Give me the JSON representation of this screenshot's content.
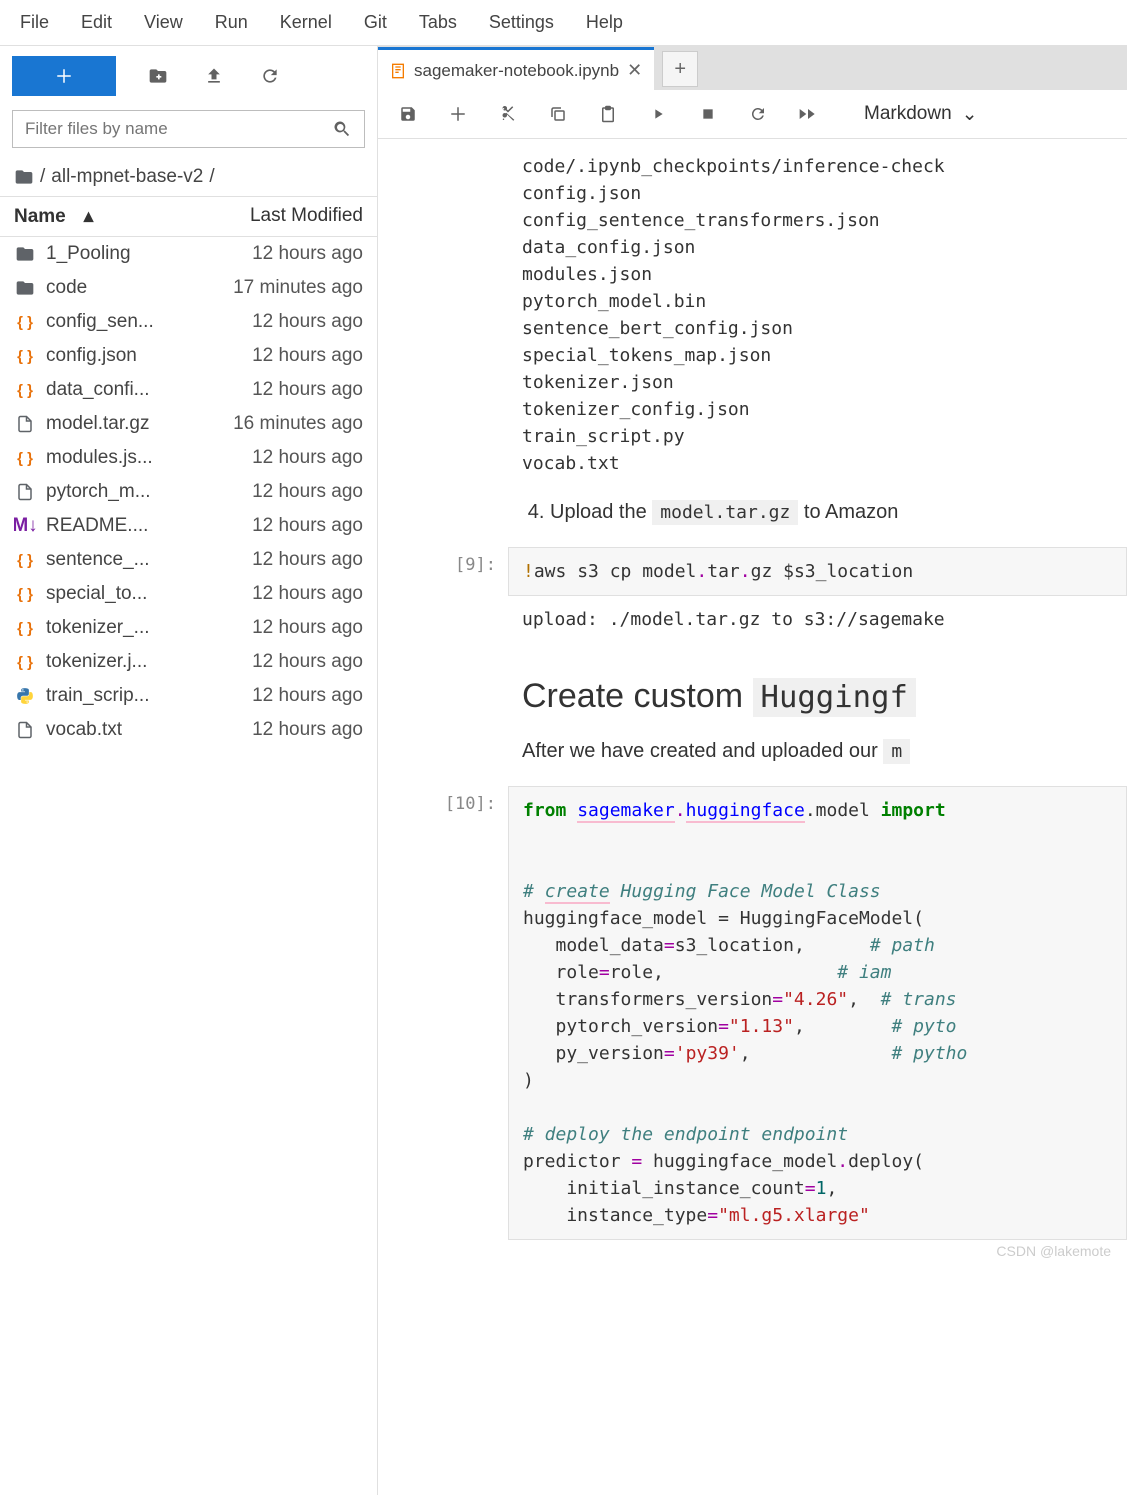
{
  "menubar": [
    "File",
    "Edit",
    "View",
    "Run",
    "Kernel",
    "Git",
    "Tabs",
    "Settings",
    "Help"
  ],
  "sidebar": {
    "filter_placeholder": "Filter files by name",
    "breadcrumb_path": "all-mpnet-base-v2",
    "columns": {
      "name": "Name",
      "modified": "Last Modified"
    },
    "files": [
      {
        "icon": "folder",
        "name": "1_Pooling",
        "modified": "12 hours ago"
      },
      {
        "icon": "folder",
        "name": "code",
        "modified": "17 minutes ago"
      },
      {
        "icon": "json",
        "name": "config_sen...",
        "modified": "12 hours ago"
      },
      {
        "icon": "json",
        "name": "config.json",
        "modified": "12 hours ago"
      },
      {
        "icon": "json",
        "name": "data_confi...",
        "modified": "12 hours ago"
      },
      {
        "icon": "file",
        "name": "model.tar.gz",
        "modified": "16 minutes ago"
      },
      {
        "icon": "json",
        "name": "modules.js...",
        "modified": "12 hours ago"
      },
      {
        "icon": "file",
        "name": "pytorch_m...",
        "modified": "12 hours ago"
      },
      {
        "icon": "md",
        "name": "README....",
        "modified": "12 hours ago"
      },
      {
        "icon": "json",
        "name": "sentence_...",
        "modified": "12 hours ago"
      },
      {
        "icon": "json",
        "name": "special_to...",
        "modified": "12 hours ago"
      },
      {
        "icon": "json",
        "name": "tokenizer_...",
        "modified": "12 hours ago"
      },
      {
        "icon": "json",
        "name": "tokenizer.j...",
        "modified": "12 hours ago"
      },
      {
        "icon": "py",
        "name": "train_scrip...",
        "modified": "12 hours ago"
      },
      {
        "icon": "file",
        "name": "vocab.txt",
        "modified": "12 hours ago"
      }
    ]
  },
  "tab": {
    "title": "sagemaker-notebook.ipynb"
  },
  "nb_toolbar": {
    "cell_type": "Markdown"
  },
  "notebook": {
    "output_files": "code/.ipynb_checkpoints/inference-check\nconfig.json\nconfig_sentence_transformers.json\ndata_config.json\nmodules.json\npytorch_model.bin\nsentence_bert_config.json\nspecial_tokens_map.json\ntokenizer.json\ntokenizer_config.json\ntrain_script.py\nvocab.txt",
    "step4_prefix": "Upload the ",
    "step4_code": "model.tar.gz",
    "step4_suffix": " to Amazon",
    "cell9_prompt": "[9]:",
    "cell9_code": {
      "mag": "!",
      "plain1": "aws s3 cp model",
      "dot1": ".",
      "plain2": "tar",
      "dot2": ".",
      "plain3": "gz $s3_location"
    },
    "cell9_output": "upload: ./model.tar.gz to s3://sagemake",
    "h2_prefix": "Create custom ",
    "h2_code": "Huggingf",
    "p_after": "After we have created and uploaded our ",
    "cell10_prompt": "[10]:",
    "cell10": {
      "l1": {
        "kw": "from",
        "mod1": "sagemaker",
        "dot": ".",
        "mod2": "huggingface",
        "plain": ".model ",
        "kw2": "import"
      },
      "l2": {
        "cm": "# ",
        "cmerr": "create",
        "cm2": " Hugging Face Model Class"
      },
      "l3": "huggingface_model = HuggingFaceModel(",
      "l4": {
        "p": "   model_data",
        "op": "=",
        "v": "s3_location,      ",
        "cm": "# path"
      },
      "l5": {
        "p": "   role",
        "op": "=",
        "v": "role,                ",
        "cm": "# iam "
      },
      "l6": {
        "p": "   transformers_version",
        "op": "=",
        "s": "\"4.26\"",
        "c": ",  ",
        "cm": "# trans"
      },
      "l7": {
        "p": "   pytorch_version",
        "op": "=",
        "s": "\"1.13\"",
        "c": ",        ",
        "cm": "# pyto"
      },
      "l8": {
        "p": "   py_version",
        "op": "=",
        "s": "'py39'",
        "c": ",             ",
        "cm": "# pytho"
      },
      "l9": ")",
      "l10": {
        "cm": "# deploy the endpoint endpoint"
      },
      "l11": {
        "p": "predictor ",
        "op": "=",
        "v": " huggingface_model",
        "dot": ".",
        "m": "deploy("
      },
      "l12": {
        "p": "    initial_instance_count",
        "op": "=",
        "n": "1",
        "c": ","
      },
      "l13": {
        "p": "    instance_type",
        "op": "=",
        "s": "\"ml.g5.xlarge\""
      }
    }
  },
  "watermark": "CSDN @lakemote"
}
